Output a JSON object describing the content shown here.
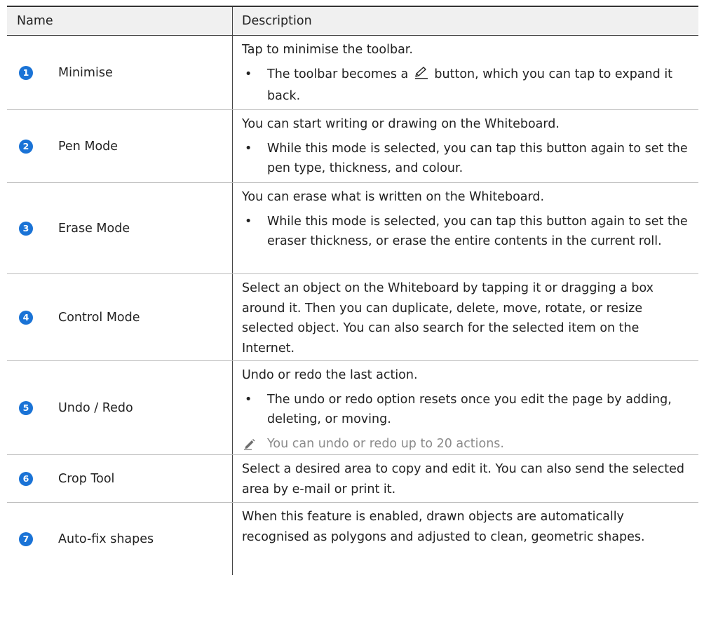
{
  "header": {
    "col_name": "Name",
    "col_description": "Description"
  },
  "rows": [
    {
      "number": "1",
      "name": "Minimise",
      "description": "Tap to minimise the toolbar.",
      "bullet_before_icon": "The toolbar becomes a",
      "bullet_icon": "pen-icon",
      "bullet_after_icon": "button, which you can tap to expand it back."
    },
    {
      "number": "2",
      "name": "Pen Mode",
      "description": "You can start writing or drawing on the Whiteboard.",
      "bullet": "While this mode is selected, you can tap this button again to set the pen type, thickness, and colour."
    },
    {
      "number": "3",
      "name": "Erase Mode",
      "description": "You can erase what is written on the Whiteboard.",
      "bullet": "While this mode is selected, you can tap this button again to set the eraser thickness, or erase the entire contents in the current roll."
    },
    {
      "number": "4",
      "name": "Control Mode",
      "description": "Select an object on the Whiteboard by tapping it or dragging a box around it. Then you can duplicate, delete, move, rotate, or resize selected object. You can also search for the selected item on the Internet."
    },
    {
      "number": "5",
      "name": "Undo / Redo",
      "description": "Undo or redo the last action.",
      "bullet": "The undo or redo option resets once you edit the page by adding, deleting, or moving.",
      "note_icon": "note-pencil-icon",
      "note": "You can undo or redo up to 20 actions."
    },
    {
      "number": "6",
      "name": "Crop Tool",
      "description": "Select a desired area to copy and edit it. You can also send the selected area by e-mail or print it."
    },
    {
      "number": "7",
      "name": "Auto-fix shapes",
      "description": "When this feature is enabled, drawn objects are automatically recognised as polygons and adjusted to clean, geometric shapes."
    }
  ],
  "colors": {
    "badge": "#1a73d6",
    "header_bg": "#f0f0f0",
    "note_text": "#8a8a8a"
  }
}
